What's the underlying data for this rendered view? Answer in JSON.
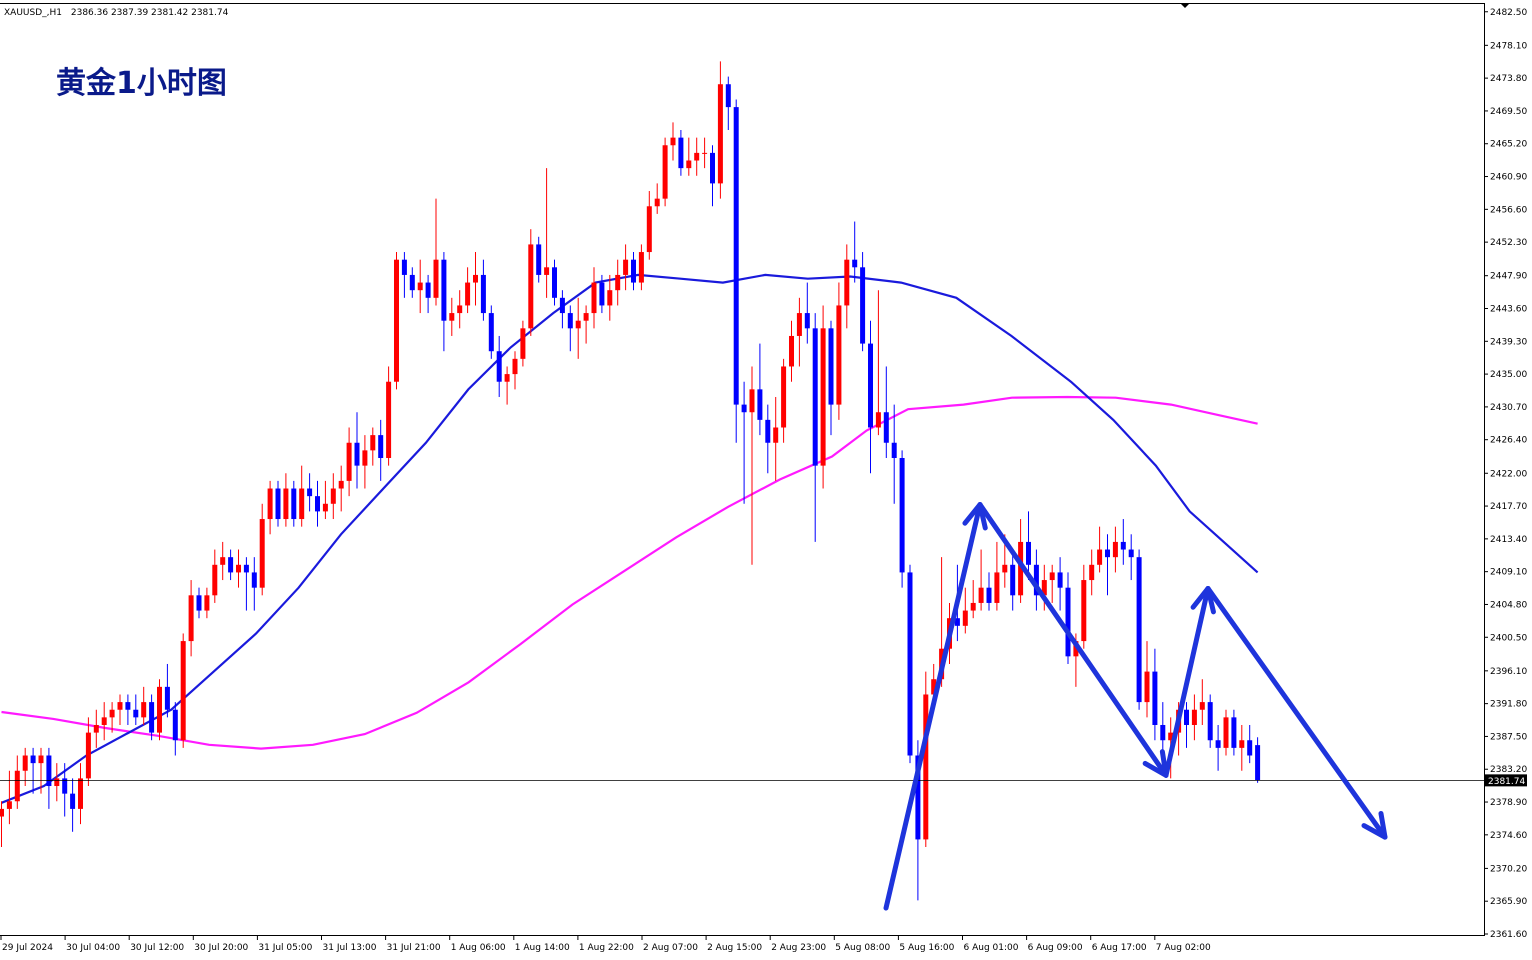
{
  "header": {
    "symbol": "XAUUSD_,H1",
    "ohlc": "2386.36 2387.39 2381.42 2381.74"
  },
  "chart_title": "黄金1小时图",
  "colors": {
    "bull": "#ff0000",
    "bear": "#0000ff",
    "ma_fast": "#1a1adc",
    "ma_slow": "#ff1aff",
    "arrow": "#1e34dc",
    "price_tag": "#000000"
  },
  "chart_data": {
    "type": "candlestick",
    "ylim": [
      2361.6,
      2482.6
    ],
    "y_ticks": [
      "2482.50",
      "2478.10",
      "2473.80",
      "2469.50",
      "2465.20",
      "2460.90",
      "2456.60",
      "2452.30",
      "2447.90",
      "2443.60",
      "2439.30",
      "2435.00",
      "2430.70",
      "2426.40",
      "2422.00",
      "2417.70",
      "2413.40",
      "2409.10",
      "2404.80",
      "2400.50",
      "2396.10",
      "2391.80",
      "2387.50",
      "2383.20",
      "2378.90",
      "2374.60",
      "2370.20",
      "2365.90",
      "2361.60"
    ],
    "x_ticks": [
      "29 Jul 2024",
      "30 Jul 04:00",
      "30 Jul 12:00",
      "30 Jul 20:00",
      "31 Jul 05:00",
      "31 Jul 13:00",
      "31 Jul 21:00",
      "1 Aug 06:00",
      "1 Aug 14:00",
      "1 Aug 22:00",
      "2 Aug 07:00",
      "2 Aug 15:00",
      "2 Aug 23:00",
      "5 Aug 08:00",
      "5 Aug 16:00",
      "6 Aug 01:00",
      "6 Aug 09:00",
      "6 Aug 17:00",
      "7 Aug 02:00"
    ],
    "current_price": "2381.74",
    "candles": [
      [
        2377,
        2379,
        2373,
        2378
      ],
      [
        2378,
        2383,
        2376,
        2379
      ],
      [
        2379,
        2385,
        2378,
        2383
      ],
      [
        2383,
        2386,
        2381,
        2385
      ],
      [
        2385,
        2386,
        2380,
        2384
      ],
      [
        2384,
        2386,
        2380,
        2385
      ],
      [
        2385,
        2386,
        2378,
        2381
      ],
      [
        2381,
        2384,
        2379,
        2382
      ],
      [
        2382,
        2384,
        2377,
        2380
      ],
      [
        2380,
        2382,
        2375,
        2378
      ],
      [
        2378,
        2384,
        2376,
        2382
      ],
      [
        2382,
        2390,
        2381,
        2388
      ],
      [
        2388,
        2391,
        2386,
        2389
      ],
      [
        2389,
        2392,
        2387,
        2390
      ],
      [
        2390,
        2392,
        2388,
        2391
      ],
      [
        2391,
        2393,
        2389,
        2392
      ],
      [
        2392,
        2393,
        2389,
        2391
      ],
      [
        2391,
        2393,
        2389,
        2390
      ],
      [
        2390,
        2394,
        2389,
        2392
      ],
      [
        2392,
        2393,
        2387,
        2388
      ],
      [
        2388,
        2395,
        2387,
        2394
      ],
      [
        2394,
        2397,
        2390,
        2391
      ],
      [
        2391,
        2392,
        2385,
        2387
      ],
      [
        2387,
        2401,
        2386,
        2400
      ],
      [
        2400,
        2408,
        2398,
        2406
      ],
      [
        2406,
        2407,
        2403,
        2404
      ],
      [
        2404,
        2407,
        2403,
        2406
      ],
      [
        2406,
        2412,
        2405,
        2410
      ],
      [
        2410,
        2413,
        2408,
        2411
      ],
      [
        2411,
        2412,
        2408,
        2409
      ],
      [
        2409,
        2412,
        2407,
        2410
      ],
      [
        2410,
        2411,
        2404,
        2409
      ],
      [
        2409,
        2411,
        2404,
        2407
      ],
      [
        2407,
        2418,
        2406,
        2416
      ],
      [
        2416,
        2421,
        2414,
        2420
      ],
      [
        2420,
        2421,
        2415,
        2416
      ],
      [
        2416,
        2422,
        2415,
        2420
      ],
      [
        2420,
        2421,
        2415,
        2416
      ],
      [
        2416,
        2423,
        2415,
        2420
      ],
      [
        2420,
        2422,
        2417,
        2419
      ],
      [
        2419,
        2421,
        2415,
        2417
      ],
      [
        2417,
        2421,
        2416,
        2418
      ],
      [
        2418,
        2422,
        2416,
        2420
      ],
      [
        2420,
        2423,
        2417,
        2421
      ],
      [
        2421,
        2428,
        2419,
        2426
      ],
      [
        2426,
        2430,
        2420,
        2423
      ],
      [
        2423,
        2427,
        2420,
        2425
      ],
      [
        2425,
        2428,
        2423,
        2427
      ],
      [
        2427,
        2429,
        2421,
        2424
      ],
      [
        2424,
        2436,
        2423,
        2434
      ],
      [
        2434,
        2451,
        2433,
        2450
      ],
      [
        2450,
        2451,
        2445,
        2448
      ],
      [
        2448,
        2449,
        2445,
        2446
      ],
      [
        2446,
        2450,
        2443,
        2447
      ],
      [
        2447,
        2448,
        2443,
        2445
      ],
      [
        2445,
        2458,
        2444,
        2450
      ],
      [
        2450,
        2451,
        2438,
        2442
      ],
      [
        2442,
        2445,
        2440,
        2443
      ],
      [
        2443,
        2446,
        2441,
        2444
      ],
      [
        2444,
        2449,
        2443,
        2447
      ],
      [
        2447,
        2451,
        2444,
        2448
      ],
      [
        2448,
        2450,
        2442,
        2443
      ],
      [
        2443,
        2444,
        2437,
        2438
      ],
      [
        2438,
        2440,
        2432,
        2434
      ],
      [
        2434,
        2436,
        2431,
        2435
      ],
      [
        2435,
        2438,
        2433,
        2437
      ],
      [
        2437,
        2442,
        2436,
        2441
      ],
      [
        2441,
        2454,
        2440,
        2452
      ],
      [
        2452,
        2453,
        2447,
        2448
      ],
      [
        2448,
        2462,
        2445,
        2449
      ],
      [
        2449,
        2450,
        2444,
        2445
      ],
      [
        2445,
        2446,
        2441,
        2443
      ],
      [
        2443,
        2444,
        2438,
        2441
      ],
      [
        2441,
        2445,
        2437,
        2442
      ],
      [
        2442,
        2444,
        2439,
        2443
      ],
      [
        2443,
        2449,
        2441,
        2447
      ],
      [
        2447,
        2448,
        2443,
        2444
      ],
      [
        2444,
        2448,
        2442,
        2446
      ],
      [
        2446,
        2450,
        2444,
        2448
      ],
      [
        2448,
        2452,
        2446,
        2450
      ],
      [
        2450,
        2451,
        2446,
        2447
      ],
      [
        2447,
        2452,
        2446,
        2451
      ],
      [
        2451,
        2459,
        2450,
        2457
      ],
      [
        2457,
        2460,
        2456,
        2458
      ],
      [
        2458,
        2466,
        2457,
        2465
      ],
      [
        2465,
        2468,
        2463,
        2466
      ],
      [
        2466,
        2467,
        2461,
        2462
      ],
      [
        2462,
        2466,
        2461,
        2463
      ],
      [
        2463,
        2466,
        2461,
        2464
      ],
      [
        2464,
        2466,
        2462,
        2464
      ],
      [
        2464,
        2465,
        2457,
        2460
      ],
      [
        2460,
        2476,
        2458,
        2473
      ],
      [
        2473,
        2474,
        2467,
        2470
      ],
      [
        2470,
        2471,
        2426,
        2431
      ],
      [
        2431,
        2434,
        2418,
        2430
      ],
      [
        2430,
        2436,
        2410,
        2433
      ],
      [
        2433,
        2439,
        2427,
        2429
      ],
      [
        2429,
        2431,
        2422,
        2426
      ],
      [
        2426,
        2432,
        2421,
        2428
      ],
      [
        2428,
        2437,
        2426,
        2436
      ],
      [
        2436,
        2442,
        2434,
        2440
      ],
      [
        2440,
        2445,
        2436,
        2443
      ],
      [
        2443,
        2447,
        2439,
        2441
      ],
      [
        2441,
        2443,
        2413,
        2423
      ],
      [
        2423,
        2444,
        2420,
        2441
      ],
      [
        2441,
        2442,
        2427,
        2431
      ],
      [
        2431,
        2447,
        2429,
        2444
      ],
      [
        2444,
        2452,
        2441,
        2450
      ],
      [
        2450,
        2455,
        2447,
        2449
      ],
      [
        2449,
        2451,
        2438,
        2439
      ],
      [
        2439,
        2442,
        2422,
        2428
      ],
      [
        2428,
        2446,
        2427,
        2430
      ],
      [
        2430,
        2436,
        2424,
        2426
      ],
      [
        2426,
        2431,
        2418,
        2424
      ],
      [
        2424,
        2425,
        2407,
        2409
      ],
      [
        2409,
        2410,
        2384,
        2385
      ],
      [
        2385,
        2387,
        2366,
        2374
      ],
      [
        2374,
        2396,
        2373,
        2393
      ],
      [
        2393,
        2397,
        2391,
        2395
      ],
      [
        2395,
        2411,
        2394,
        2399
      ],
      [
        2399,
        2405,
        2397,
        2403
      ],
      [
        2403,
        2410,
        2400,
        2402
      ],
      [
        2402,
        2407,
        2401,
        2404
      ],
      [
        2404,
        2408,
        2403,
        2405
      ],
      [
        2405,
        2412,
        2404,
        2407
      ],
      [
        2407,
        2409,
        2404,
        2405
      ],
      [
        2405,
        2413,
        2404,
        2409
      ],
      [
        2409,
        2414,
        2407,
        2410
      ],
      [
        2410,
        2412,
        2404,
        2406
      ],
      [
        2406,
        2416,
        2405,
        2413
      ],
      [
        2413,
        2417,
        2408,
        2410
      ],
      [
        2410,
        2412,
        2404,
        2406
      ],
      [
        2406,
        2410,
        2404,
        2408
      ],
      [
        2408,
        2410,
        2405,
        2409
      ],
      [
        2409,
        2411,
        2404,
        2407
      ],
      [
        2407,
        2409,
        2397,
        2398
      ],
      [
        2398,
        2401,
        2394,
        2400
      ],
      [
        2400,
        2410,
        2399,
        2408
      ],
      [
        2408,
        2412,
        2406,
        2410
      ],
      [
        2410,
        2415,
        2409,
        2412
      ],
      [
        2412,
        2414,
        2406,
        2411
      ],
      [
        2411,
        2415,
        2409,
        2413
      ],
      [
        2413,
        2416,
        2410,
        2412
      ],
      [
        2412,
        2414,
        2408,
        2411
      ],
      [
        2411,
        2412,
        2391,
        2392
      ],
      [
        2392,
        2400,
        2390,
        2396
      ],
      [
        2396,
        2399,
        2387,
        2389
      ],
      [
        2389,
        2392,
        2383,
        2387
      ],
      [
        2387,
        2390,
        2382,
        2388
      ],
      [
        2388,
        2392,
        2385,
        2391
      ],
      [
        2391,
        2392,
        2386,
        2389
      ],
      [
        2389,
        2393,
        2387,
        2391
      ],
      [
        2391,
        2395,
        2389,
        2392
      ],
      [
        2392,
        2393,
        2386,
        2387
      ],
      [
        2387,
        2389,
        2383,
        2386
      ],
      [
        2386,
        2391,
        2385,
        2390
      ],
      [
        2390,
        2391,
        2385,
        2386
      ],
      [
        2386,
        2389,
        2383,
        2387
      ],
      [
        2387,
        2389,
        2384,
        2385
      ],
      [
        2386.36,
        2387.39,
        2381.42,
        2381.74
      ]
    ],
    "ma_fast": [
      [
        0,
        2378.8
      ],
      [
        10,
        2381
      ],
      [
        20,
        2385
      ],
      [
        30,
        2388
      ],
      [
        40,
        2391
      ],
      [
        50,
        2396
      ],
      [
        60,
        2401
      ],
      [
        70,
        2407
      ],
      [
        80,
        2414
      ],
      [
        90,
        2420
      ],
      [
        100,
        2426
      ],
      [
        110,
        2433
      ],
      [
        120,
        2438.5
      ],
      [
        130,
        2443
      ],
      [
        140,
        2447
      ],
      [
        150,
        2448
      ],
      [
        160,
        2447.5
      ],
      [
        170,
        2447
      ],
      [
        180,
        2448
      ],
      [
        190,
        2447.5
      ],
      [
        200,
        2447.8
      ],
      [
        212,
        2447
      ],
      [
        225,
        2445
      ],
      [
        238,
        2440
      ],
      [
        252,
        2434
      ],
      [
        262,
        2429
      ],
      [
        272,
        2423
      ],
      [
        280,
        2417
      ],
      [
        288,
        2413
      ],
      [
        296,
        2409
      ]
    ],
    "ma_slow": [
      [
        0,
        2390.7
      ],
      [
        15,
        2389.8
      ],
      [
        30,
        2388.6
      ],
      [
        45,
        2387.6
      ],
      [
        60,
        2386.4
      ],
      [
        75,
        2385.9
      ],
      [
        90,
        2386.4
      ],
      [
        105,
        2387.8
      ],
      [
        120,
        2390.6
      ],
      [
        135,
        2394.6
      ],
      [
        150,
        2399.6
      ],
      [
        165,
        2404.8
      ],
      [
        180,
        2409.2
      ],
      [
        195,
        2413.6
      ],
      [
        210,
        2417.6
      ],
      [
        225,
        2421.2
      ],
      [
        240,
        2424.2
      ],
      [
        250,
        2427.6
      ],
      [
        262,
        2430.4
      ],
      [
        278,
        2431
      ],
      [
        292,
        2431.9
      ],
      [
        308,
        2432
      ],
      [
        322,
        2431.9
      ],
      [
        338,
        2431
      ],
      [
        352,
        2429.6
      ],
      [
        363,
        2428.5
      ]
    ],
    "ma_slow_x_range": [
      0,
      363
    ],
    "ma_fast_x_range": [
      0,
      296
    ],
    "arrows": [
      {
        "from": [
          2365.0,
          0.1065
        ],
        "to": [
          2417.9,
          0.1225
        ],
        "head": true
      },
      {
        "from": [
          2417.9,
          0.1225
        ],
        "to": [
          2382.4,
          0.146
        ],
        "head": true
      },
      {
        "from": [
          2382.4,
          0.146
        ],
        "to": [
          2406.9,
          0.1578
        ],
        "head": true
      },
      {
        "from": [
          2406.9,
          0.1578
        ],
        "to": [
          2374.3,
          0.1803
        ],
        "head": true
      }
    ]
  }
}
